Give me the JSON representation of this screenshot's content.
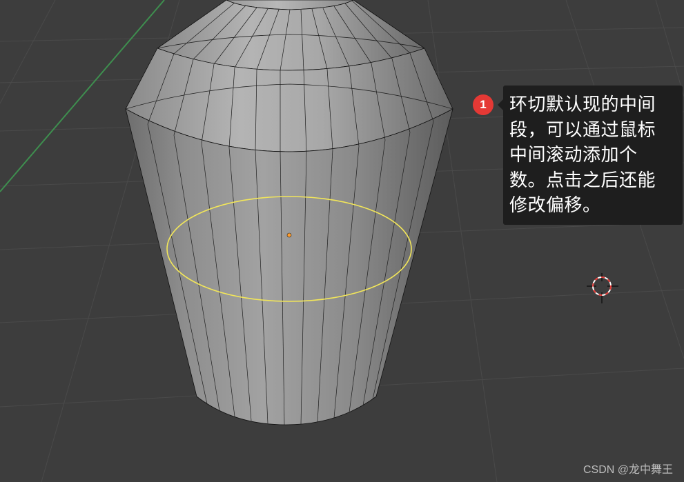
{
  "viewport": {
    "grid_color": "#4a4a4a",
    "background_color": "#3d3d3d",
    "axis_color": "#3e8f4f",
    "mesh_color": "#8e8e8e",
    "edge_color": "#111111",
    "loop_cut_color": "#f2e659",
    "origin_color": "#ff9d2e",
    "cursor_colors": [
      "#e53935",
      "#ffffff"
    ]
  },
  "annotation": {
    "badge_number": "1",
    "badge_color": "#e53935",
    "lines": [
      "环切默认现的中间",
      "段，可以通过鼠标",
      "中间滚动添加个",
      "数。点击之后还能",
      "修改偏移。"
    ]
  },
  "watermark": "CSDN @龙中舞王"
}
